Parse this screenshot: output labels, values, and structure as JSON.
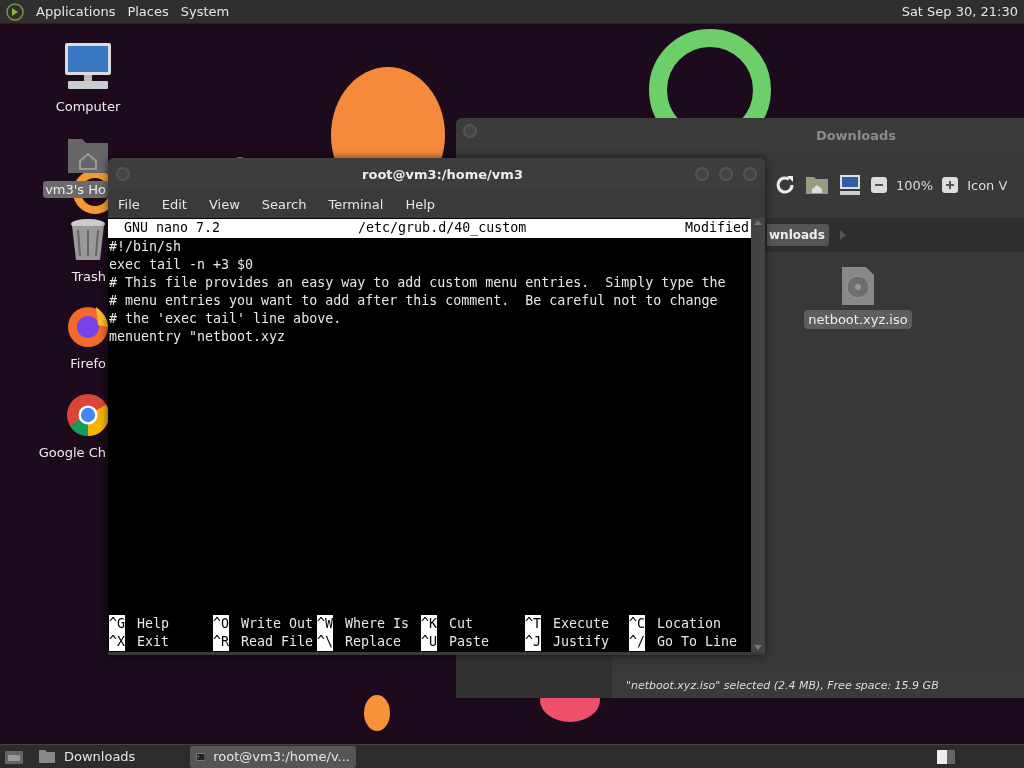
{
  "top_panel": {
    "menus": [
      "Applications",
      "Places",
      "System"
    ],
    "clock": "Sat Sep 30, 21:30"
  },
  "desktop_icons": [
    {
      "kind": "computer",
      "label": "Computer",
      "selected": false
    },
    {
      "kind": "home",
      "label": "vm3's Ho",
      "selected": true
    },
    {
      "kind": "trash",
      "label": "Trash",
      "selected": false
    },
    {
      "kind": "firefox",
      "label": "Firefo",
      "selected": false
    },
    {
      "kind": "chrome",
      "label": "Google Ch",
      "selected": false
    }
  ],
  "file_manager": {
    "title": "Downloads",
    "zoom": "100%",
    "view": "Icon V",
    "path_button": "wnloads",
    "files": [
      {
        "name": "netboot.xyz.iso",
        "selected": true
      }
    ],
    "status": "\"netboot.xyz.iso\" selected (2.4 MB), Free space: 15.9 GB"
  },
  "terminal": {
    "title": "root@vm3:/home/vm3",
    "menu": [
      "File",
      "Edit",
      "View",
      "Search",
      "Terminal",
      "Help"
    ],
    "nano": {
      "version": "GNU nano 7.2",
      "file": "/etc/grub.d/40_custom",
      "status": "Modified",
      "lines": [
        "#!/bin/sh",
        "exec tail -n +3 $0",
        "# This file provides an easy way to add custom menu entries.  Simply type the",
        "# menu entries you want to add after this comment.  Be careful not to change",
        "# the 'exec tail' line above.",
        "menuentry \"netboot.xyz"
      ],
      "shortcuts": [
        {
          "key": "^G",
          "label": "Help"
        },
        {
          "key": "^X",
          "label": "Exit"
        },
        {
          "key": "^O",
          "label": "Write Out"
        },
        {
          "key": "^R",
          "label": "Read File"
        },
        {
          "key": "^W",
          "label": "Where Is"
        },
        {
          "key": "^\\",
          "label": "Replace"
        },
        {
          "key": "^K",
          "label": "Cut"
        },
        {
          "key": "^U",
          "label": "Paste"
        },
        {
          "key": "^T",
          "label": "Execute"
        },
        {
          "key": "^J",
          "label": "Justify"
        },
        {
          "key": "^C",
          "label": "Location"
        },
        {
          "key": "^/",
          "label": "Go To Line"
        }
      ]
    }
  },
  "taskbar": {
    "items": [
      {
        "kind": "folder",
        "label": "Downloads",
        "selected": false
      },
      {
        "kind": "terminal",
        "label": "root@vm3:/home/v...",
        "selected": true
      }
    ]
  }
}
